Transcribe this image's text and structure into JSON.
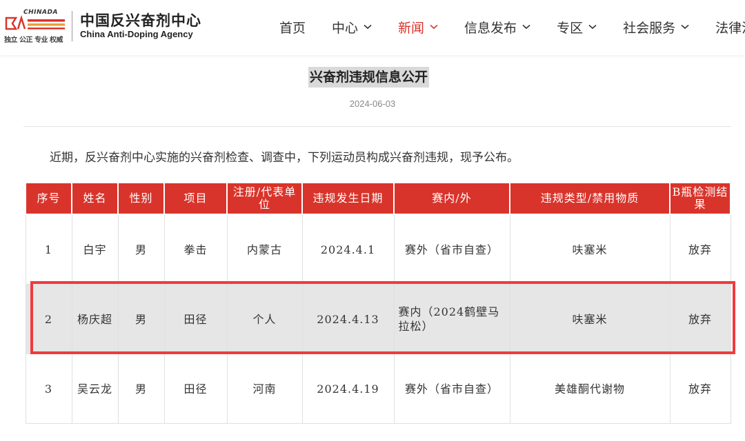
{
  "logo": {
    "brand_en_small": "CHINADA",
    "motto": "独立 公正 专业 权威",
    "name_cn": "中国反兴奋剂中心",
    "name_en": "China Anti-Doping Agency"
  },
  "nav": [
    {
      "label": "首页",
      "dropdown": false,
      "active": false
    },
    {
      "label": "中心",
      "dropdown": true,
      "active": false
    },
    {
      "label": "新闻",
      "dropdown": true,
      "active": true
    },
    {
      "label": "信息发布",
      "dropdown": true,
      "active": false
    },
    {
      "label": "专区",
      "dropdown": true,
      "active": false
    },
    {
      "label": "社会服务",
      "dropdown": true,
      "active": false
    },
    {
      "label": "法律法",
      "dropdown": false,
      "active": false
    }
  ],
  "article": {
    "title": "兴奋剂违规信息公开",
    "date": "2024-06-03",
    "intro": "近期，反兴奋剂中心实施的兴奋剂检查、调查中，下列运动员构成兴奋剂违规，现予公布。"
  },
  "table": {
    "headers": [
      "序号",
      "姓名",
      "性别",
      "项目",
      "注册/代表单位",
      "违规发生日期",
      "赛内/外",
      "违规类型/禁用物质",
      "B瓶检测结果"
    ],
    "rows": [
      [
        "1",
        "白宇",
        "男",
        "拳击",
        "内蒙古",
        "2024.4.1",
        "赛外（省市自查）",
        "呋塞米",
        "放弃"
      ],
      [
        "2",
        "杨庆超",
        "男",
        "田径",
        "个人",
        "2024.4.13",
        "赛内（2024鹤壁马拉松）",
        "呋塞米",
        "放弃"
      ],
      [
        "3",
        "吴云龙",
        "男",
        "田径",
        "河南",
        "2024.4.19",
        "赛外（省市自查）",
        "美雄酮代谢物",
        "放弃"
      ]
    ]
  },
  "colors": {
    "accent": "#d9342b",
    "highlight_border": "#ef3a3e",
    "highlight_row": "#e6e6e6"
  }
}
